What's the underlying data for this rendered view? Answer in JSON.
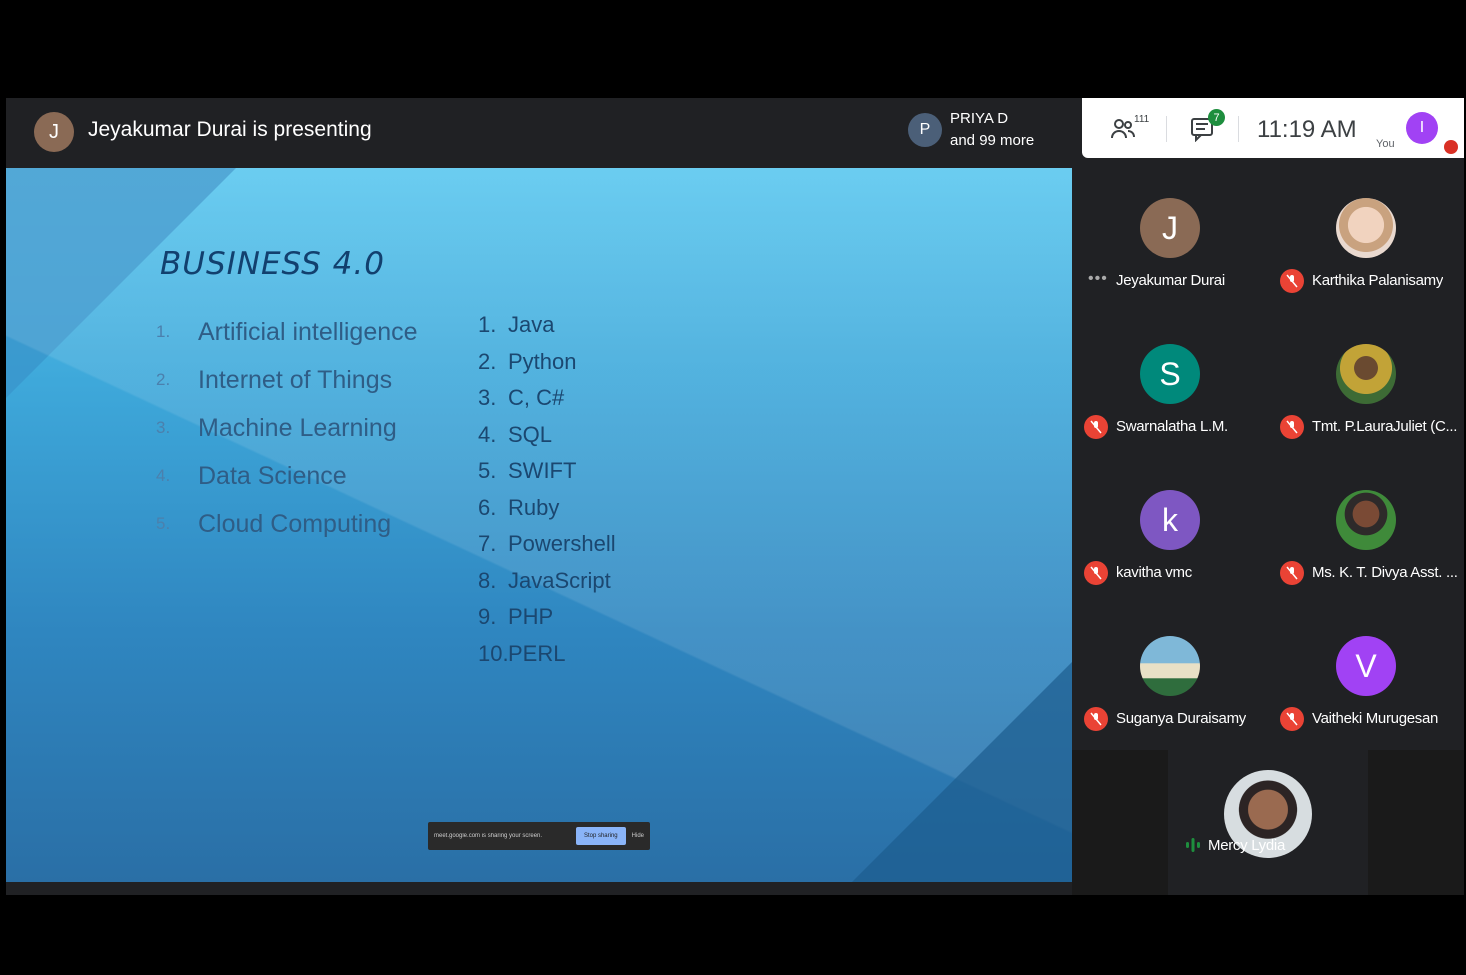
{
  "header": {
    "presenter_initial": "J",
    "presenting_text": "Jeyakumar Durai is presenting",
    "viewer_initial": "P",
    "viewer_name": "PRIYA D",
    "viewer_more": "and 99 more"
  },
  "controls": {
    "people_icon": "people-icon",
    "people_count": "111",
    "chat_icon": "chat-icon",
    "chat_badge": "7",
    "time": "11:19 AM",
    "self_label": "You",
    "self_initial": "I"
  },
  "slide": {
    "title": "BUSINESS 4.0",
    "topics": [
      {
        "num": "1.",
        "label": "Artificial intelligence"
      },
      {
        "num": "2.",
        "label": "Internet of Things"
      },
      {
        "num": "3.",
        "label": "Machine Learning"
      },
      {
        "num": "4.",
        "label": "Data Science"
      },
      {
        "num": "5.",
        "label": "Cloud Computing"
      }
    ],
    "languages": [
      {
        "num": "1.",
        "label": "Java"
      },
      {
        "num": "2.",
        "label": "Python"
      },
      {
        "num": "3.",
        "label": "C, C#"
      },
      {
        "num": "4.",
        "label": "SQL"
      },
      {
        "num": "5.",
        "label": "SWIFT"
      },
      {
        "num": "6.",
        "label": "Ruby"
      },
      {
        "num": "7.",
        "label": "Powershell"
      },
      {
        "num": "8.",
        "label": "JavaScript"
      },
      {
        "num": "9.",
        "label": "PHP"
      },
      {
        "num": "10.",
        "label": "PERL"
      }
    ],
    "share_bar": {
      "message": "meet.google.com is sharing your screen.",
      "stop_label": "Stop sharing",
      "hide_label": "Hide"
    }
  },
  "participants": [
    {
      "name": "Jeyakumar Durai",
      "initial": "J",
      "color": "#8a6a55",
      "muted": false,
      "photo": false
    },
    {
      "name": "Karthika Palanisamy",
      "initial": "",
      "color": "#e8c7b0",
      "muted": true,
      "photo": true
    },
    {
      "name": "Swarnalatha L.M.",
      "initial": "S",
      "color": "#00897b",
      "muted": true,
      "photo": false
    },
    {
      "name": "Tmt. P.LauraJuliet (C...",
      "initial": "",
      "color": "#6a7a3a",
      "muted": true,
      "photo": true
    },
    {
      "name": "kavitha vmc",
      "initial": "k",
      "color": "#7e57c2",
      "muted": true,
      "photo": false
    },
    {
      "name": "Ms. K. T. Divya Asst. ...",
      "initial": "",
      "color": "#3f6b3a",
      "muted": true,
      "photo": true
    },
    {
      "name": "Suganya Duraisamy",
      "initial": "",
      "color": "#5aa0c8",
      "muted": true,
      "photo": true
    },
    {
      "name": "Vaitheki Murugesan",
      "initial": "V",
      "color": "#a142f4",
      "muted": true,
      "photo": false
    }
  ],
  "active_speaker": {
    "name": "Mercy Lydia",
    "color": "#cfd8dc"
  },
  "colors": {
    "mute_red": "#ea4335",
    "meet_bg": "#202124",
    "speaking_green": "#1e8e3e"
  }
}
